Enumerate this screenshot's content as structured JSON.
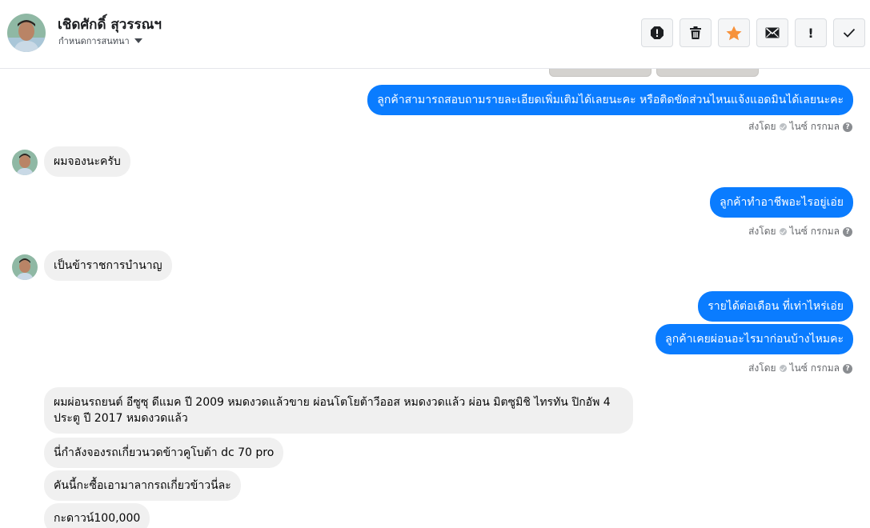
{
  "header": {
    "contact_name": "เชิดศักดิ์ สุวรรณฯ",
    "assign_label": "กำหนดการสนทนา"
  },
  "actions": [
    {
      "name": "report-icon",
      "color": "#1c1e21"
    },
    {
      "name": "trash-icon",
      "color": "#1c1e21"
    },
    {
      "name": "star-icon",
      "color": "#f7923b"
    },
    {
      "name": "mail-icon",
      "color": "#1c1e21"
    },
    {
      "name": "exclamation-icon",
      "label": "!"
    },
    {
      "name": "checkmark-icon",
      "color": "#1c1e21"
    }
  ],
  "sent_by": {
    "prefix": "ส่งโดย",
    "sender": "ไนซ์ กรกมล",
    "help": "?"
  },
  "messages": {
    "m1": "ลูกค้าสามารถสอบถามรายละเอียดเพิ่มเติมได้เลยนะคะ หรือติดขัดส่วนไหนแจ้งแอดมินได้เลยนะคะ",
    "m2": "ผมจองนะครับ",
    "m3": "ลูกค้าทำอาชีพอะไรอยู่เอ่ย",
    "m4": "เป็นข้าราชการบำนาญ",
    "m5": "รายได้ต่อเดือน ที่เท่าไหร่เอ่ย",
    "m6": "ลูกค้าเคยผ่อนอะไรมาก่อนบ้างไหมคะ",
    "m7": "ผมผ่อนรถยนต์ อีซูซุ ดีแมค ปี 2009  หมดงวดแล้วขาย ผ่อนโตโยต้าวีออส หมดงวดแล้ว ผ่อน มิตซูมิชิ ไทรทัน ปิกอัพ 4 ประตู ปี 2017  หมดงวดแล้ว",
    "m8": "นี่กำลังจองรถเกี่ยวนวดข้าวคูโบต้า dc 70 pro",
    "m9": "คันนี้กะซื้อเอามาลากรถเกี่ยวข้าวนี่ละ",
    "m10": "กะดาวน์100,000"
  },
  "colors": {
    "outgoing_bubble": "#0a7cff",
    "incoming_bubble": "#f0f0f0",
    "star": "#f7923b"
  }
}
